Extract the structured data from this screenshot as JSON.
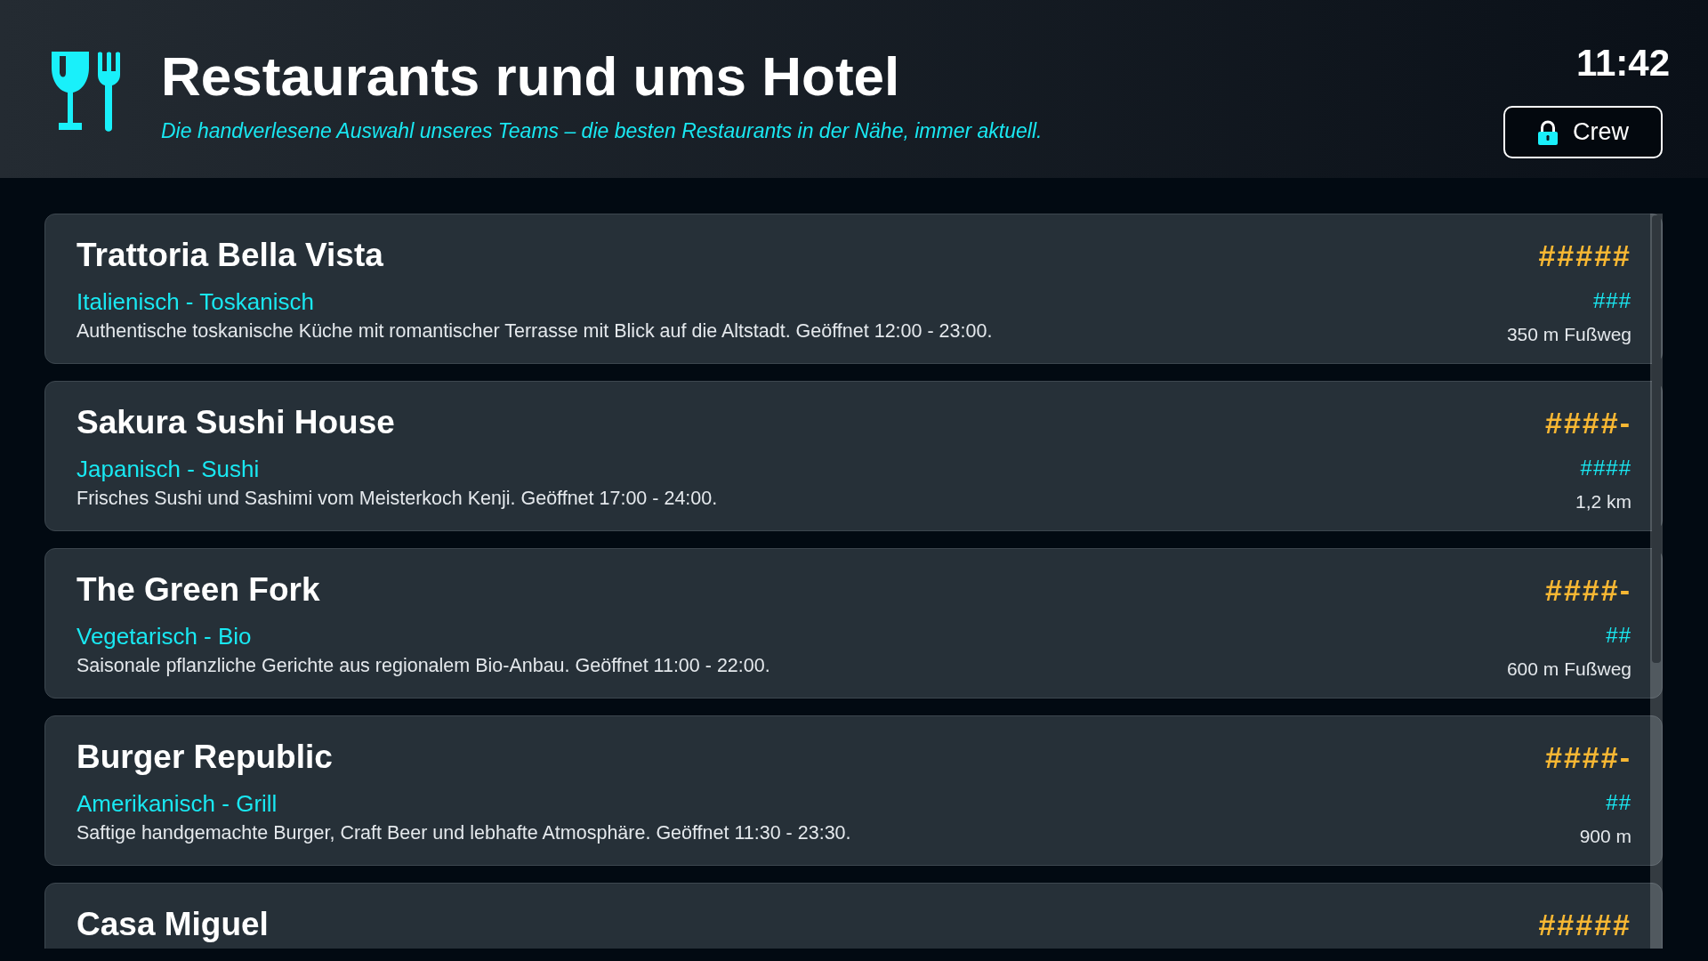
{
  "header": {
    "title": "Restaurants rund ums Hotel",
    "subtitle": "Die handverlesene Auswahl unseres Teams – die besten Restaurants in der Nähe, immer aktuell.",
    "time": "11:42",
    "crew_button": {
      "label": "Crew"
    }
  },
  "restaurants": [
    {
      "name": "Trattoria Bella Vista",
      "cuisine": "Italienisch - Toskanisch",
      "description": "Authentische toskanische Küche mit romantischer Terrasse mit Blick auf die Altstadt. Geöffnet 12:00 - 23:00.",
      "rating": "#####",
      "price": "###",
      "distance": "350 m Fußweg"
    },
    {
      "name": "Sakura Sushi House",
      "cuisine": "Japanisch - Sushi",
      "description": "Frisches Sushi und Sashimi vom Meisterkoch Kenji. Geöffnet 17:00 - 24:00.",
      "rating": "####-",
      "price": "####",
      "distance": "1,2 km"
    },
    {
      "name": "The Green Fork",
      "cuisine": "Vegetarisch - Bio",
      "description": "Saisonale pflanzliche Gerichte aus regionalem Bio-Anbau. Geöffnet 11:00 - 22:00.",
      "rating": "####-",
      "price": "##",
      "distance": "600 m Fußweg"
    },
    {
      "name": "Burger Republic",
      "cuisine": "Amerikanisch - Grill",
      "description": "Saftige handgemachte Burger, Craft Beer und lebhafte Atmosphäre. Geöffnet 11:30 - 23:30.",
      "rating": "####-",
      "price": "##",
      "distance": "900 m"
    },
    {
      "name": "Casa Miguel",
      "rating": "#####"
    }
  ]
}
